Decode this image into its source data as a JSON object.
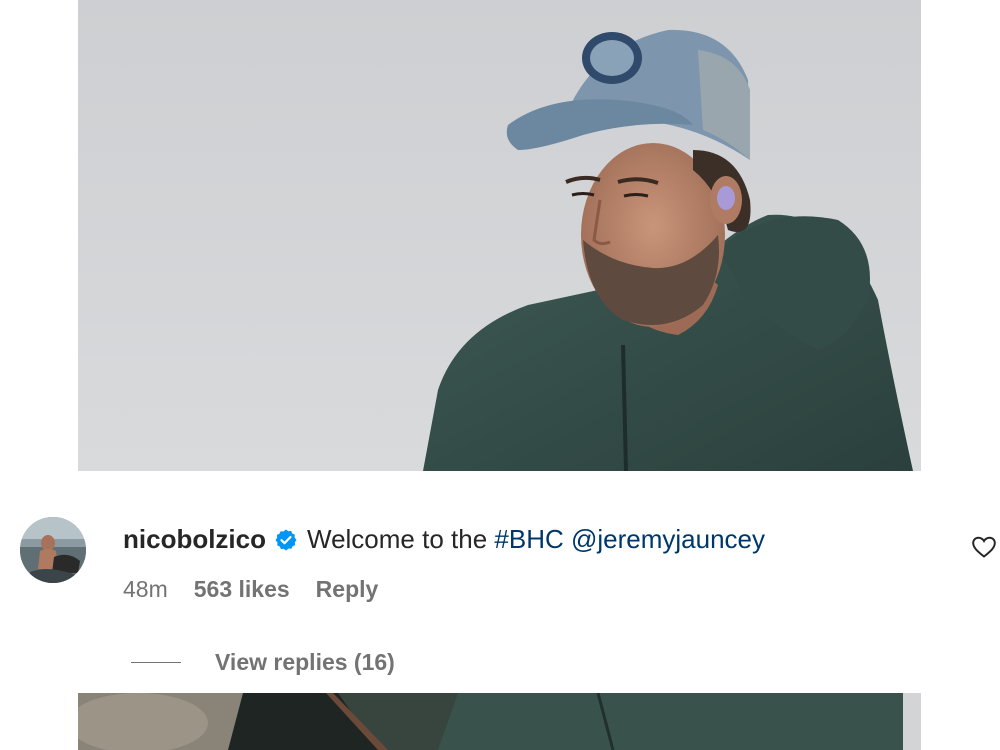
{
  "post": {
    "top_image_alt": "man in cap and green jacket against grey sky",
    "bottom_image_alt": "next post image"
  },
  "comment": {
    "username": "nicobolzico",
    "text_prefix": "Welcome to the ",
    "hashtag": "#BHC",
    "mention": "@jeremyjauncey",
    "time": "48m",
    "likes": "563 likes",
    "reply_label": "Reply",
    "view_replies_label": "View replies (16)"
  },
  "icons": {
    "verified": "verified-badge-icon",
    "like": "heart-icon"
  },
  "colors": {
    "text": "#262626",
    "secondary": "#737373",
    "link": "#00376b",
    "verified": "#0095f6"
  }
}
